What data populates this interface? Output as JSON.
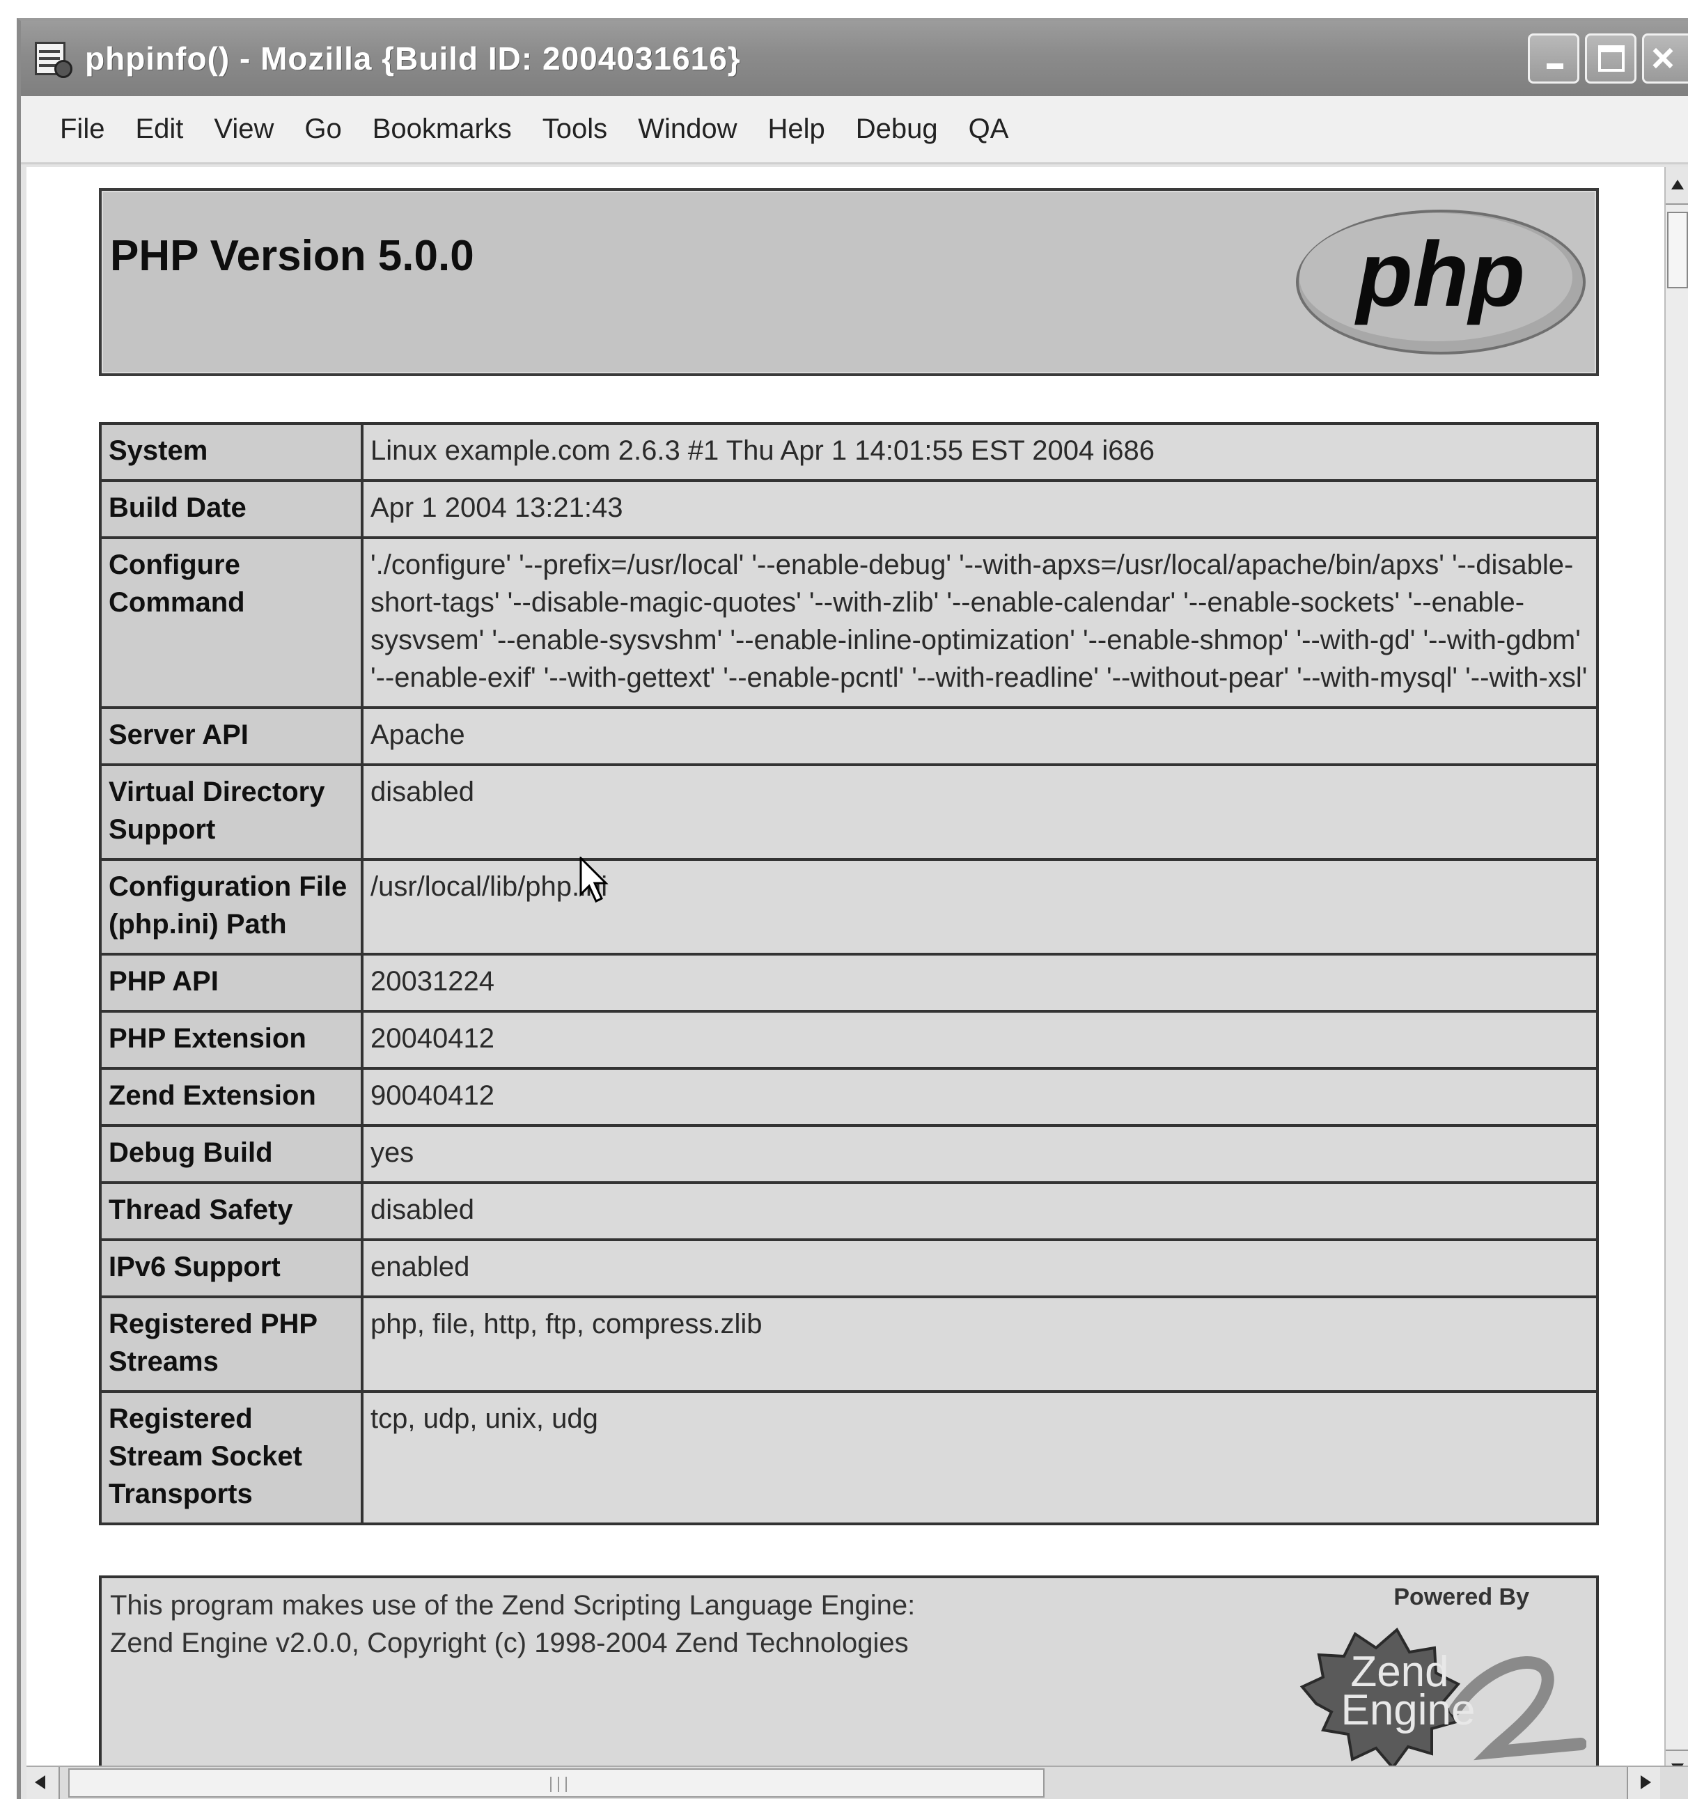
{
  "window": {
    "title": "phpinfo() - Mozilla {Build ID: 2004031616}",
    "icon": "document-icon"
  },
  "menu": [
    "File",
    "Edit",
    "View",
    "Go",
    "Bookmarks",
    "Tools",
    "Window",
    "Help",
    "Debug",
    "QA"
  ],
  "header": {
    "version": "PHP Version 5.0.0",
    "logo_text": "php"
  },
  "info_rows": [
    {
      "key": "System",
      "value": "Linux example.com 2.6.3 #1 Thu Apr 1 14:01:55 EST 2004 i686"
    },
    {
      "key": "Build Date",
      "value": "Apr 1 2004 13:21:43"
    },
    {
      "key": "Configure Command",
      "value": "'./configure' '--prefix=/usr/local' '--enable-debug' '--with-apxs=/usr/local/apache/bin/apxs' '--disable-short-tags' '--disable-magic-quotes' '--with-zlib' '--enable-calendar' '--enable-sockets' '--enable-sysvsem' '--enable-sysvshm' '--enable-inline-optimization' '--enable-shmop' '--with-gd' '--with-gdbm' '--enable-exif' '--with-gettext' '--enable-pcntl' '--with-readline' '--without-pear' '--with-mysql' '--with-xsl'"
    },
    {
      "key": "Server API",
      "value": "Apache"
    },
    {
      "key": "Virtual Directory Support",
      "value": "disabled"
    },
    {
      "key": "Configuration File (php.ini) Path",
      "value": "/usr/local/lib/php.ini"
    },
    {
      "key": "PHP API",
      "value": "20031224"
    },
    {
      "key": "PHP Extension",
      "value": "20040412"
    },
    {
      "key": "Zend Extension",
      "value": "90040412"
    },
    {
      "key": "Debug Build",
      "value": "yes"
    },
    {
      "key": "Thread Safety",
      "value": "disabled"
    },
    {
      "key": "IPv6 Support",
      "value": "enabled"
    },
    {
      "key": "Registered PHP Streams",
      "value": "php, file, http, ftp, compress.zlib"
    },
    {
      "key": "Registered Stream Socket Transports",
      "value": "tcp, udp, unix, udg"
    }
  ],
  "footer": {
    "line1": "This program makes use of the Zend Scripting Language Engine:",
    "line2": "Zend Engine v2.0.0, Copyright (c) 1998-2004 Zend Technologies",
    "powered_by": "Powered By",
    "logo_line1": "Zend",
    "logo_line2": "Engine",
    "logo_number": "2"
  }
}
